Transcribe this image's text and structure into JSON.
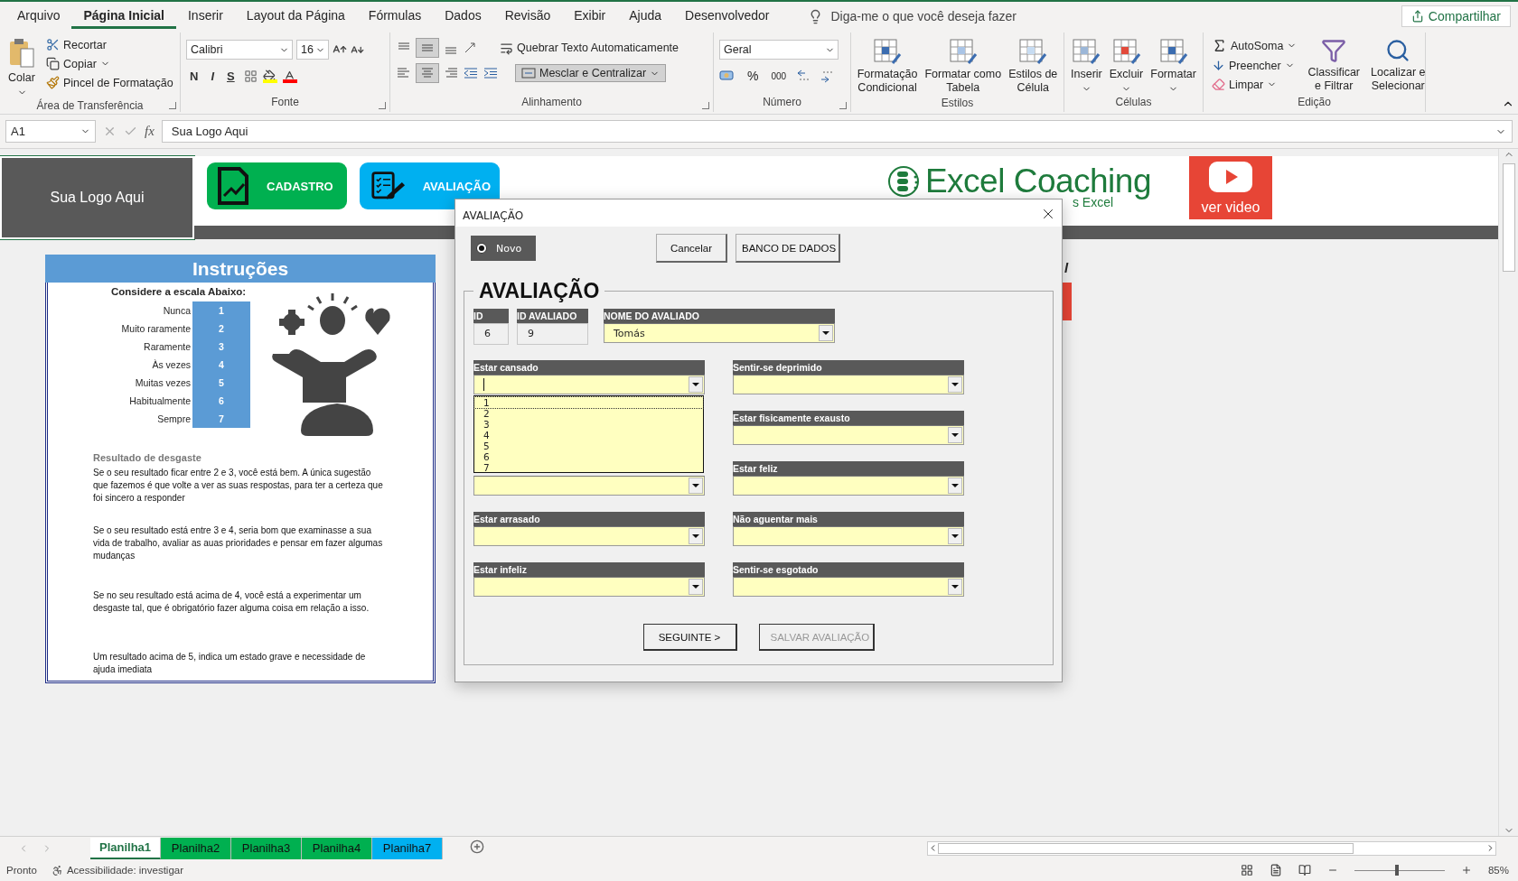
{
  "menu_tabs": [
    {
      "label": "Arquivo",
      "selected": false
    },
    {
      "label": "Página Inicial",
      "selected": true
    },
    {
      "label": "Inserir",
      "selected": false
    },
    {
      "label": "Layout da Página",
      "selected": false
    },
    {
      "label": "Fórmulas",
      "selected": false
    },
    {
      "label": "Dados",
      "selected": false
    },
    {
      "label": "Revisão",
      "selected": false
    },
    {
      "label": "Exibir",
      "selected": false
    },
    {
      "label": "Ajuda",
      "selected": false
    },
    {
      "label": "Desenvolvedor",
      "selected": false
    }
  ],
  "tell_me": "Diga-me o que você deseja fazer",
  "share": "Compartilhar",
  "ribbon": {
    "clipboard": {
      "label": "Área de Transferência",
      "paste": "Colar",
      "items": [
        {
          "label": "Recortar",
          "menu": false
        },
        {
          "label": "Copiar",
          "menu": true
        },
        {
          "label": "Pincel de Formatação",
          "menu": false
        }
      ]
    },
    "font": {
      "label": "Fonte",
      "name": "Calibri",
      "size": "16",
      "styles": [
        "N",
        "I",
        "S"
      ]
    },
    "alignment": {
      "label": "Alinhamento",
      "wrap": "Quebrar Texto Automaticamente",
      "merge": "Mesclar e Centralizar"
    },
    "number": {
      "label": "Número",
      "format": "Geral",
      "percent": "%",
      "thousands": "000"
    },
    "styles": {
      "label": "Estilos",
      "items": [
        "Formatação\nCondicional",
        "Formatar como\nTabela",
        "Estilos de\nCélula"
      ]
    },
    "cells": {
      "label": "Células",
      "items": [
        "Inserir",
        "Excluir",
        "Formatar"
      ]
    },
    "editing": {
      "label": "Edição",
      "items": [
        {
          "label": "AutoSoma",
          "menu": true
        },
        {
          "label": "Preencher",
          "menu": true
        },
        {
          "label": "Limpar",
          "menu": true
        }
      ],
      "large": [
        "Classificar\ne Filtrar",
        "Localizar e\nSelecionar"
      ]
    }
  },
  "formula_bar": {
    "name_box": "A1",
    "function_label": "fx",
    "value": "Sua Logo Aqui"
  },
  "sheet": {
    "logo_cell": "Sua Logo Aqui",
    "nav_buttons": [
      {
        "label": "CADASTRO",
        "color": "#00b050"
      },
      {
        "label": "AVALIAÇÃO",
        "color": "#00b0f0"
      }
    ],
    "brand": "Excel Coaching",
    "brand_tagline": "s Excel",
    "video": "ver video",
    "side_fragment": "l",
    "instructions": {
      "title": "Instruções",
      "scale_title": "Considere a escala Abaixo:",
      "scale": [
        {
          "label": "Nunca",
          "value": "1"
        },
        {
          "label": "Muito raramente",
          "value": "2"
        },
        {
          "label": "Raramente",
          "value": "3"
        },
        {
          "label": "Às vezes",
          "value": "4"
        },
        {
          "label": "Muitas vezes",
          "value": "5"
        },
        {
          "label": "Habitualmente",
          "value": "6"
        },
        {
          "label": "Sempre",
          "value": "7"
        }
      ],
      "result_title": "Resultado de desgaste",
      "paragraphs": [
        "Se o seu resultado ficar entre 2 e 3, você está bem. A única sugestão que fazemos é que  volte a  ver as suas respostas, para ter a certeza que foi sincero a responder",
        "Se o seu resultado está entre 3 e 4, seria bom que examinasse a sua vida de trabalho, avaliar as auas prioridades e pensar em fazer algumas mudanças",
        "Se no seu resultado está acima de 4, você está a experimentar um desgaste tal, que é obrigatório  fazer alguma coisa em relação a isso.",
        "Um resultado acima de 5, indica um estado grave e necessidade de ajuda imediata"
      ]
    }
  },
  "dialog": {
    "title": "AVALIAÇÃO",
    "option": {
      "label": "Novo",
      "selected": true
    },
    "buttons": [
      "Cancelar",
      "BANCO DE DADOS"
    ],
    "frame_title": "AVALIAÇÃO",
    "id_fields": [
      {
        "label": "ID",
        "value": "6"
      },
      {
        "label": "ID AVALIADO",
        "value": "9"
      }
    ],
    "name_field": {
      "label": "NOME DO AVALIADO",
      "value": "Tomás"
    },
    "left_questions": [
      {
        "label": "Estar cansado",
        "expanded": true,
        "options": [
          "1",
          "2",
          "3",
          "4",
          "5",
          "6",
          "7"
        ]
      },
      {
        "kind": "covered",
        "expanded": false
      },
      {
        "label": "Estar arrasado",
        "expanded": false
      },
      {
        "label": "Estar infeliz",
        "expanded": false
      }
    ],
    "right_questions": [
      {
        "label": "Sentir-se deprimido",
        "expanded": false
      },
      {
        "label": "Estar fisicamente exausto",
        "expanded": false
      },
      {
        "label": "Estar feliz",
        "expanded": false
      },
      {
        "label": "Não aguentar mais",
        "expanded": false
      },
      {
        "label": "Sentir-se esgotado",
        "expanded": false
      }
    ],
    "actions": [
      {
        "label": "SEGUINTE >",
        "disabled": false
      },
      {
        "label": "SALVAR AVALIAÇÃO",
        "disabled": true
      }
    ]
  },
  "sheet_tabs": [
    {
      "label": "Planilha1",
      "selected": true,
      "color": "#ffffff"
    },
    {
      "label": "Planilha2",
      "selected": false,
      "color": "#00b050"
    },
    {
      "label": "Planilha3",
      "selected": false,
      "color": "#00b050"
    },
    {
      "label": "Planilha4",
      "selected": false,
      "color": "#00b050"
    },
    {
      "label": "Planilha7",
      "selected": false,
      "color": "#00b0f0"
    }
  ],
  "status": {
    "ready": "Pronto",
    "accessibility": "Acessibilidade: investigar",
    "zoom": "85%",
    "zoom_slider": {
      "level": 0.45
    }
  }
}
